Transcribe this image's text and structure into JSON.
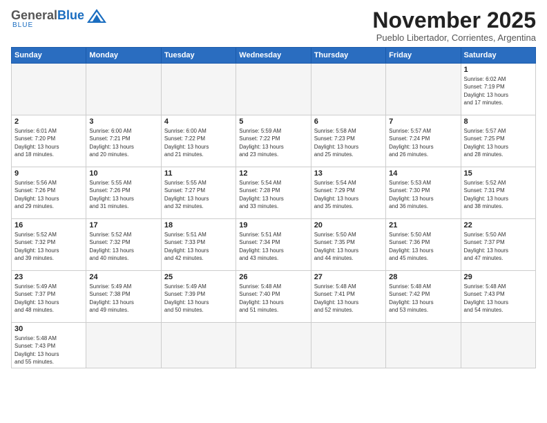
{
  "header": {
    "logo_general": "General",
    "logo_blue": "Blue",
    "month_title": "November 2025",
    "subtitle": "Pueblo Libertador, Corrientes, Argentina"
  },
  "weekdays": [
    "Sunday",
    "Monday",
    "Tuesday",
    "Wednesday",
    "Thursday",
    "Friday",
    "Saturday"
  ],
  "weeks": [
    [
      {
        "day": "",
        "empty": true
      },
      {
        "day": "",
        "empty": true
      },
      {
        "day": "",
        "empty": true
      },
      {
        "day": "",
        "empty": true
      },
      {
        "day": "",
        "empty": true
      },
      {
        "day": "",
        "empty": true
      },
      {
        "day": "1",
        "info": "Sunrise: 6:02 AM\nSunset: 7:19 PM\nDaylight: 13 hours\nand 17 minutes."
      }
    ],
    [
      {
        "day": "2",
        "info": "Sunrise: 6:01 AM\nSunset: 7:20 PM\nDaylight: 13 hours\nand 18 minutes."
      },
      {
        "day": "3",
        "info": "Sunrise: 6:00 AM\nSunset: 7:21 PM\nDaylight: 13 hours\nand 20 minutes."
      },
      {
        "day": "4",
        "info": "Sunrise: 6:00 AM\nSunset: 7:22 PM\nDaylight: 13 hours\nand 21 minutes."
      },
      {
        "day": "5",
        "info": "Sunrise: 5:59 AM\nSunset: 7:22 PM\nDaylight: 13 hours\nand 23 minutes."
      },
      {
        "day": "6",
        "info": "Sunrise: 5:58 AM\nSunset: 7:23 PM\nDaylight: 13 hours\nand 25 minutes."
      },
      {
        "day": "7",
        "info": "Sunrise: 5:57 AM\nSunset: 7:24 PM\nDaylight: 13 hours\nand 26 minutes."
      },
      {
        "day": "8",
        "info": "Sunrise: 5:57 AM\nSunset: 7:25 PM\nDaylight: 13 hours\nand 28 minutes."
      }
    ],
    [
      {
        "day": "9",
        "info": "Sunrise: 5:56 AM\nSunset: 7:26 PM\nDaylight: 13 hours\nand 29 minutes."
      },
      {
        "day": "10",
        "info": "Sunrise: 5:55 AM\nSunset: 7:26 PM\nDaylight: 13 hours\nand 31 minutes."
      },
      {
        "day": "11",
        "info": "Sunrise: 5:55 AM\nSunset: 7:27 PM\nDaylight: 13 hours\nand 32 minutes."
      },
      {
        "day": "12",
        "info": "Sunrise: 5:54 AM\nSunset: 7:28 PM\nDaylight: 13 hours\nand 33 minutes."
      },
      {
        "day": "13",
        "info": "Sunrise: 5:54 AM\nSunset: 7:29 PM\nDaylight: 13 hours\nand 35 minutes."
      },
      {
        "day": "14",
        "info": "Sunrise: 5:53 AM\nSunset: 7:30 PM\nDaylight: 13 hours\nand 36 minutes."
      },
      {
        "day": "15",
        "info": "Sunrise: 5:52 AM\nSunset: 7:31 PM\nDaylight: 13 hours\nand 38 minutes."
      }
    ],
    [
      {
        "day": "16",
        "info": "Sunrise: 5:52 AM\nSunset: 7:32 PM\nDaylight: 13 hours\nand 39 minutes."
      },
      {
        "day": "17",
        "info": "Sunrise: 5:52 AM\nSunset: 7:32 PM\nDaylight: 13 hours\nand 40 minutes."
      },
      {
        "day": "18",
        "info": "Sunrise: 5:51 AM\nSunset: 7:33 PM\nDaylight: 13 hours\nand 42 minutes."
      },
      {
        "day": "19",
        "info": "Sunrise: 5:51 AM\nSunset: 7:34 PM\nDaylight: 13 hours\nand 43 minutes."
      },
      {
        "day": "20",
        "info": "Sunrise: 5:50 AM\nSunset: 7:35 PM\nDaylight: 13 hours\nand 44 minutes."
      },
      {
        "day": "21",
        "info": "Sunrise: 5:50 AM\nSunset: 7:36 PM\nDaylight: 13 hours\nand 45 minutes."
      },
      {
        "day": "22",
        "info": "Sunrise: 5:50 AM\nSunset: 7:37 PM\nDaylight: 13 hours\nand 47 minutes."
      }
    ],
    [
      {
        "day": "23",
        "info": "Sunrise: 5:49 AM\nSunset: 7:37 PM\nDaylight: 13 hours\nand 48 minutes."
      },
      {
        "day": "24",
        "info": "Sunrise: 5:49 AM\nSunset: 7:38 PM\nDaylight: 13 hours\nand 49 minutes."
      },
      {
        "day": "25",
        "info": "Sunrise: 5:49 AM\nSunset: 7:39 PM\nDaylight: 13 hours\nand 50 minutes."
      },
      {
        "day": "26",
        "info": "Sunrise: 5:48 AM\nSunset: 7:40 PM\nDaylight: 13 hours\nand 51 minutes."
      },
      {
        "day": "27",
        "info": "Sunrise: 5:48 AM\nSunset: 7:41 PM\nDaylight: 13 hours\nand 52 minutes."
      },
      {
        "day": "28",
        "info": "Sunrise: 5:48 AM\nSunset: 7:42 PM\nDaylight: 13 hours\nand 53 minutes."
      },
      {
        "day": "29",
        "info": "Sunrise: 5:48 AM\nSunset: 7:43 PM\nDaylight: 13 hours\nand 54 minutes."
      }
    ],
    [
      {
        "day": "30",
        "info": "Sunrise: 5:48 AM\nSunset: 7:43 PM\nDaylight: 13 hours\nand 55 minutes."
      },
      {
        "day": "",
        "empty": true
      },
      {
        "day": "",
        "empty": true
      },
      {
        "day": "",
        "empty": true
      },
      {
        "day": "",
        "empty": true
      },
      {
        "day": "",
        "empty": true
      },
      {
        "day": "",
        "empty": true
      }
    ]
  ]
}
